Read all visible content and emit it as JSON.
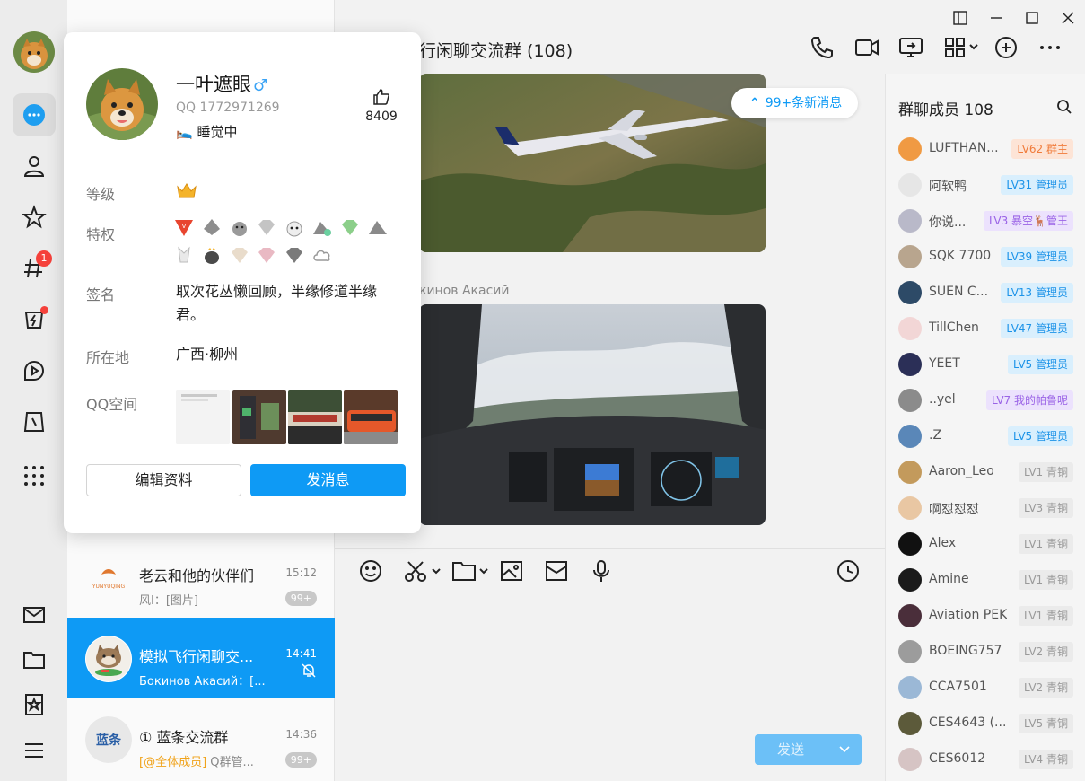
{
  "colors": {
    "accent": "#0e9af5",
    "badge": "#f5413b"
  },
  "rail": {
    "message_badge": "",
    "channel_badge": "1"
  },
  "conversations": [
    {
      "name": "老云和他的伙伴们",
      "time": "15:12",
      "preview": "风I：[图片]",
      "count": "99+",
      "avatar_text": "YUNYUQING"
    },
    {
      "name": "模拟飞行闲聊交...",
      "time": "14:41",
      "preview": "Бокинов Акасий：[...",
      "count": ""
    },
    {
      "name": "① 蓝条交流群",
      "time": "14:36",
      "mention": "[@全体成员]",
      "preview": " Q群管...",
      "count": "99+",
      "avatar_text": "蓝条"
    }
  ],
  "chat": {
    "title": "行闲聊交流群 (108)",
    "new_messages": "99+条新消息",
    "sender": "кинов Акасий",
    "send_label": "发送"
  },
  "members": {
    "title": "群聊成员 108",
    "list": [
      {
        "name": "LUFTHAN...",
        "tag": "LV62 群主",
        "tone": "orange",
        "color": "#f09a43"
      },
      {
        "name": "阿软鸭",
        "tag": "LV31 管理员",
        "tone": "blue",
        "color": "#e6e6e6"
      },
      {
        "name": "你说...",
        "tag": "LV3 暴空🦌管王",
        "tone": "purple",
        "color": "#b9b9c9"
      },
      {
        "name": "SQK 7700",
        "tag": "LV39 管理员",
        "tone": "blue",
        "color": "#b8a58e"
      },
      {
        "name": "SUEN C...",
        "tag": "LV13 管理员",
        "tone": "blue",
        "color": "#2d4a67"
      },
      {
        "name": "TillChen",
        "tag": "LV47 管理员",
        "tone": "blue",
        "color": "#f2d6d6"
      },
      {
        "name": "YEET",
        "tag": "LV5 管理员",
        "tone": "blue",
        "color": "#2b2f57"
      },
      {
        "name": "..yel",
        "tag": "LV7 我的帕鲁呢",
        "tone": "purple",
        "color": "#8b8b8b"
      },
      {
        "name": ".Z",
        "tag": "LV5 管理员",
        "tone": "blue",
        "color": "#5a87b8"
      },
      {
        "name": "Aaron_Leo",
        "tag": "LV1 青铜",
        "tone": "gray",
        "color": "#c39a5c"
      },
      {
        "name": "啊怼怼怼",
        "tag": "LV3 青铜",
        "tone": "gray",
        "color": "#e9c7a3"
      },
      {
        "name": "Alex",
        "tag": "LV1 青铜",
        "tone": "gray",
        "color": "#111111"
      },
      {
        "name": "Amine",
        "tag": "LV1 青铜",
        "tone": "gray",
        "color": "#1a1a1a"
      },
      {
        "name": "Aviation PEK",
        "tag": "LV1 青铜",
        "tone": "gray",
        "color": "#4a2e3a"
      },
      {
        "name": "BOEING757",
        "tag": "LV2 青铜",
        "tone": "gray",
        "color": "#9c9c9c"
      },
      {
        "name": "CCA7501",
        "tag": "LV2 青铜",
        "tone": "gray",
        "color": "#9bb8d6"
      },
      {
        "name": "CES4643 (...",
        "tag": "LV5 青铜",
        "tone": "gray",
        "color": "#5c5a3a"
      },
      {
        "name": "CES6012",
        "tag": "LV4 青铜",
        "tone": "gray",
        "color": "#d6c4c4"
      }
    ]
  },
  "profile": {
    "name": "一叶遮眼",
    "gender": "♂",
    "qq": "QQ 1772971269",
    "status": "🛌 睡觉中",
    "likes": "8409",
    "labels": {
      "level": "等级",
      "privilege": "特权",
      "signature": "签名",
      "location": "所在地",
      "zone": "QQ空间"
    },
    "signature": "取次花丛懒回顾，半缘修道半缘君。",
    "location": "广西·柳州",
    "edit_button": "编辑资料",
    "message_button": "发消息"
  }
}
